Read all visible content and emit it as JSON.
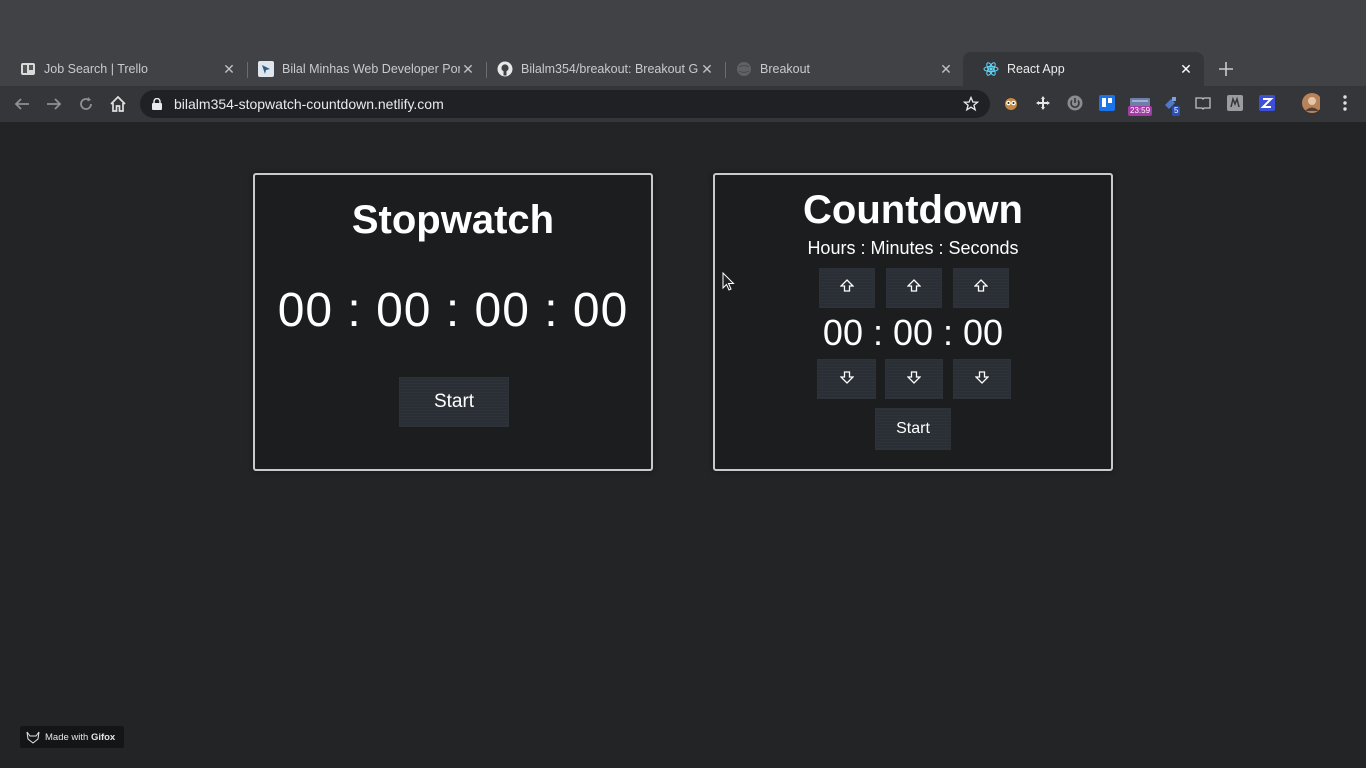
{
  "browser": {
    "tabs": [
      {
        "title": "Job Search | Trello",
        "icon": "trello-icon"
      },
      {
        "title": "Bilal Minhas Web Developer Port",
        "icon": "portfolio-icon"
      },
      {
        "title": "Bilalm354/breakout: Breakout G",
        "icon": "github-icon"
      },
      {
        "title": "Breakout",
        "icon": "globe-icon"
      },
      {
        "title": "React App",
        "icon": "react-icon",
        "active": true
      }
    ],
    "url": "bilalm354-stopwatch-countdown.netlify.com",
    "extension_badges": {
      "timer": "23:59",
      "count": "5"
    }
  },
  "stopwatch": {
    "title": "Stopwatch",
    "time": "00 : 00 : 00 : 00",
    "start_label": "Start"
  },
  "countdown": {
    "title": "Countdown",
    "subtitle": "Hours : Minutes : Seconds",
    "time": "00 : 00 : 00",
    "start_label": "Start"
  },
  "watermark": {
    "prefix": "Made with ",
    "brand": "Gifox"
  }
}
